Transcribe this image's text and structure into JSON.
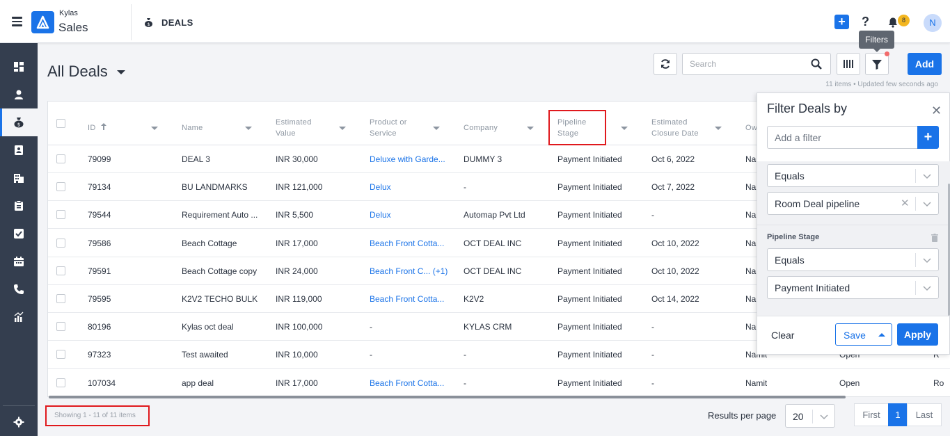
{
  "app": {
    "brand_top": "Kylas",
    "brand_bottom": "Sales",
    "module": "DEALS",
    "notification_count": "8",
    "avatar_initial": "N",
    "accent": "#1a73e8"
  },
  "page": {
    "title": "All Deals",
    "updated": "11 items • Updated few seconds ago"
  },
  "toolbar": {
    "search_placeholder": "Search",
    "add_label": "Add",
    "filters_tooltip": "Filters"
  },
  "table": {
    "columns": [
      {
        "label": "ID"
      },
      {
        "label": "Name"
      },
      {
        "label": "Estimated Value",
        "l1": "Estimated",
        "l2": "Value"
      },
      {
        "label": "Product or Service",
        "l1": "Product or",
        "l2": "Service"
      },
      {
        "label": "Company"
      },
      {
        "label": "Pipeline Stage",
        "l1": "Pipeline",
        "l2": "Stage"
      },
      {
        "label": "Estimated Closure Date",
        "l1": "Estimated",
        "l2": "Closure Date"
      },
      {
        "label": "Ow"
      }
    ],
    "rows": [
      {
        "id": "79099",
        "name": "DEAL 3",
        "value": "INR 30,000",
        "product": "Deluxe with Garde...",
        "product_link": true,
        "company": "DUMMY 3",
        "stage": "Payment Initiated",
        "closure": "Oct 6, 2022",
        "owner": "Nam",
        "status": "",
        "extra": ""
      },
      {
        "id": "79134",
        "name": "BU LANDMARKS",
        "value": "INR 121,000",
        "product": "Delux",
        "product_link": true,
        "company": "-",
        "stage": "Payment Initiated",
        "closure": "Oct 7, 2022",
        "owner": "Nam",
        "status": "",
        "extra": ""
      },
      {
        "id": "79544",
        "name": "Requirement Auto ...",
        "value": "INR 5,500",
        "product": "Delux",
        "product_link": true,
        "company": "Automap Pvt Ltd",
        "stage": "Payment Initiated",
        "closure": "-",
        "owner": "Nam",
        "status": "",
        "extra": ""
      },
      {
        "id": "79586",
        "name": "Beach Cottage",
        "value": "INR 17,000",
        "product": "Beach Front Cotta...",
        "product_link": true,
        "company": "OCT DEAL INC",
        "stage": "Payment Initiated",
        "closure": "Oct 10, 2022",
        "owner": "Nar",
        "status": "",
        "extra": ""
      },
      {
        "id": "79591",
        "name": "Beach Cottage copy",
        "value": "INR 24,000",
        "product": "Beach Front C...  (+1)",
        "product_link": true,
        "company": "OCT DEAL INC",
        "stage": "Payment Initiated",
        "closure": "Oct 10, 2022",
        "owner": "Nar",
        "status": "",
        "extra": ""
      },
      {
        "id": "79595",
        "name": "K2V2 TECHO BULK",
        "value": "INR 119,000",
        "product": "Beach Front Cotta...",
        "product_link": true,
        "company": "K2V2",
        "stage": "Payment Initiated",
        "closure": "Oct 14, 2022",
        "owner": "Nar",
        "status": "",
        "extra": ""
      },
      {
        "id": "80196",
        "name": "Kylas oct deal",
        "value": "INR 100,000",
        "product": "-",
        "product_link": false,
        "company": "KYLAS CRM",
        "stage": "Payment Initiated",
        "closure": "-",
        "owner": "Nar",
        "status": "",
        "extra": ""
      },
      {
        "id": "97323",
        "name": "Test awaited",
        "value": "INR 10,000",
        "product": "-",
        "product_link": false,
        "company": "-",
        "stage": "Payment Initiated",
        "closure": "-",
        "owner": "Namit",
        "status": "Open",
        "extra": "R"
      },
      {
        "id": "107034",
        "name": "app deal",
        "value": "INR 17,000",
        "product": "Beach Front Cotta...",
        "product_link": true,
        "company": "-",
        "stage": "Payment Initiated",
        "closure": "-",
        "owner": "Namit",
        "status": "Open",
        "extra": "Ro"
      }
    ]
  },
  "footer": {
    "showing": "Showing 1 - 11 of 11 items",
    "results_per_page_label": "Results per page",
    "per_page_value": "20",
    "pager_first": "First",
    "pager_current": "1",
    "pager_last": "Last"
  },
  "filter_panel": {
    "title": "Filter Deals by",
    "add_placeholder": "Add a filter",
    "pipeline_operator": "Equals",
    "pipeline_value": "Room Deal pipeline",
    "stage_label": "Pipeline Stage",
    "stage_operator": "Equals",
    "stage_value": "Payment Initiated",
    "clear_label": "Clear",
    "save_label": "Save",
    "apply_label": "Apply"
  }
}
